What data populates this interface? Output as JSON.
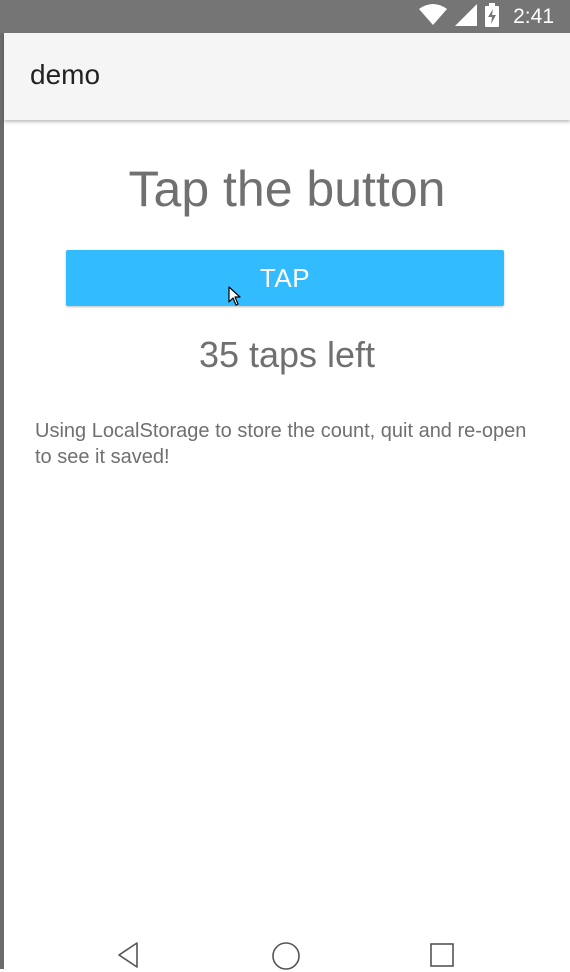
{
  "status_bar": {
    "time": "2:41"
  },
  "app_bar": {
    "title": "demo"
  },
  "main": {
    "heading": "Tap the button",
    "tap_button_label": "TAP",
    "taps_left_text": "35 taps left",
    "description": "Using LocalStorage to store the count, quit and re-open to see it saved!"
  },
  "colors": {
    "accent": "#33bbff",
    "status_bar": "#757575",
    "app_bar": "#f5f5f5",
    "text_gray": "#707070"
  },
  "icons": {
    "wifi": "wifi-icon",
    "signal": "signal-icon",
    "battery": "battery-charging-icon",
    "back": "back-icon",
    "home": "home-icon",
    "recents": "recents-icon",
    "cursor": "mouse-cursor-icon"
  }
}
